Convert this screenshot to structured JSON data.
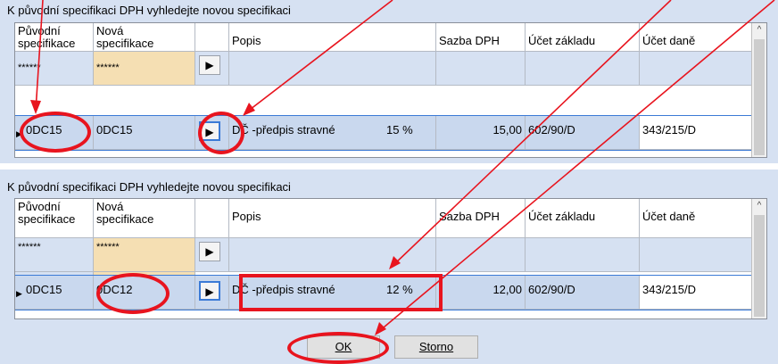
{
  "dialog_title": "K původní  specifikaci DPH vyhledejte novou specifikaci",
  "columns": {
    "original": [
      "Původní",
      "specifikace"
    ],
    "new": [
      "Nová",
      "specifikace"
    ],
    "description": "Popis",
    "vat_rate": "Sazba DPH",
    "base_account": "Účet základu",
    "tax_account": "Účet daně"
  },
  "filter_value": "******",
  "panel_before": {
    "original": "0DC15",
    "new": "0DC15",
    "description": "DČ -předpis stravné",
    "description_pct": "15 %",
    "vat_rate": "15,00",
    "base_account": "602/90/D",
    "tax_account": "343/215/D"
  },
  "panel_after": {
    "original": "0DC15",
    "new": "0DC12",
    "description": "DČ -předpis stravné",
    "description_pct": "12 %",
    "vat_rate": "12,00",
    "base_account": "602/90/D",
    "tax_account": "343/215/D"
  },
  "buttons": {
    "ok_label": "OK",
    "cancel_label": "Storno"
  },
  "icons": {
    "arrow_button": "play-triangle-icon",
    "row_indicator": "row-pointer-icon",
    "scroll_up": "chevron-up-icon"
  },
  "colors": {
    "panel_bg": "#d6e1f2",
    "filter_new_bg": "#f5dfb3",
    "highlight_border": "#3b7ad6",
    "annotation_red": "#e8141e"
  }
}
